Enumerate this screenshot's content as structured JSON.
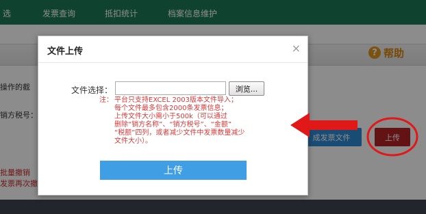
{
  "nav": {
    "items": [
      "选",
      "发票查询",
      "抵扣统计",
      "档案信息维护"
    ]
  },
  "help": {
    "label": "帮助"
  },
  "background": {
    "operation_text": "操作的截",
    "seller_tax_label": "销方税号：",
    "revoke_line1": "批量撤销",
    "revoke_line2": "发票再次撤销",
    "blue_button_label": "成发票文件",
    "upload_button_label": "上传"
  },
  "modal": {
    "title": "文件上传",
    "close_symbol": "×",
    "file_label": "文件选择：",
    "file_value": "",
    "browse_label": "浏览...",
    "note_prefix": "注：",
    "note_lines": [
      "平台只支持EXCEL 2003版本文件导入；",
      "每个文件最多包含2000条发票信息；",
      "上传文件大小需小于500k（可以通过",
      "删除“销方名称”、“销方税号”、“金额”",
      "“税额”四列，或者减少文件中发票数量减少",
      "文件大小）。"
    ],
    "submit_label": "上传"
  },
  "colors": {
    "nav_bg": "#1e7a56",
    "note_red": "#d33a3a",
    "submit_blue": "#3f9ee4",
    "annotation_red": "#e01818"
  }
}
